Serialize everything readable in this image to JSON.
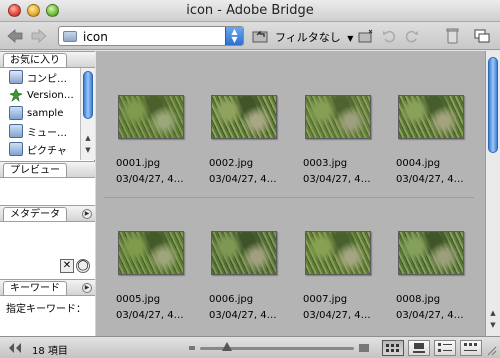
{
  "window": {
    "title": "icon - Adobe Bridge"
  },
  "toolbar": {
    "path": "icon",
    "filter_label": "フィルタなし",
    "filter_arrow": "▼"
  },
  "panels": {
    "favorites_tab": "お気に入り",
    "favorites": [
      {
        "label": "コンピ…",
        "icon": "computer-icon"
      },
      {
        "label": "Version…",
        "icon": "version-cue-icon"
      },
      {
        "label": "sample",
        "icon": "document-folder-icon"
      },
      {
        "label": "ミュー…",
        "icon": "music-folder-icon"
      },
      {
        "label": "ピクチャ",
        "icon": "pictures-folder-icon"
      }
    ],
    "preview_tab": "プレビュー",
    "metadata_tab": "メタデータ",
    "keywords_tab": "キーワード",
    "keywords_label": "指定キーワード："
  },
  "files": [
    {
      "name": "0001.jpg",
      "date": "03/04/27, 4…"
    },
    {
      "name": "0002.jpg",
      "date": "03/04/27, 4…"
    },
    {
      "name": "0003.jpg",
      "date": "03/04/27, 4…"
    },
    {
      "name": "0004.jpg",
      "date": "03/04/27, 4…"
    },
    {
      "name": "0005.jpg",
      "date": "03/04/27, 4…"
    },
    {
      "name": "0006.jpg",
      "date": "03/04/27, 4…"
    },
    {
      "name": "0007.jpg",
      "date": "03/04/27, 4…"
    },
    {
      "name": "0008.jpg",
      "date": "03/04/27, 4…"
    }
  ],
  "status": {
    "count": "18 項目"
  },
  "colors": {
    "accent": "#3d7fd6",
    "content_bg": "#b4b4b4"
  }
}
